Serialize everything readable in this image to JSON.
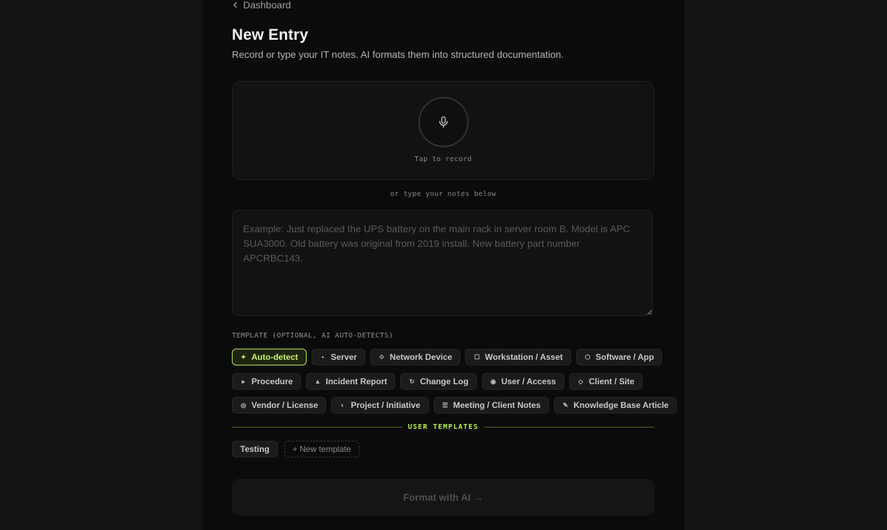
{
  "nav": {
    "back_label": "Dashboard"
  },
  "header": {
    "title": "New Entry",
    "subtitle": "Record or type your IT notes. AI formats them into structured documentation."
  },
  "recorder": {
    "label": "Tap to record"
  },
  "notes": {
    "separator": "or type your notes below",
    "placeholder": "Example: Just replaced the UPS battery on the main rack in server room B. Model is APC SUA3000. Old battery was original from 2019 install. New battery part number APCRBC143.",
    "value": ""
  },
  "templates": {
    "heading": "TEMPLATE (OPTIONAL, AI AUTO-DETECTS)",
    "selected": "Auto-detect",
    "rows": [
      [
        {
          "label": "Auto-detect",
          "icon": "sparkle-icon",
          "glyph": "✦"
        },
        {
          "label": "Server",
          "icon": "server-icon",
          "glyph": "▪"
        },
        {
          "label": "Network Device",
          "icon": "network-icon",
          "glyph": "⟐"
        },
        {
          "label": "Workstation / Asset",
          "icon": "monitor-icon",
          "glyph": "☐"
        },
        {
          "label": "Software / App",
          "icon": "hexagon-icon",
          "glyph": "⬡"
        }
      ],
      [
        {
          "label": "Procedure",
          "icon": "play-icon",
          "glyph": "▸"
        },
        {
          "label": "Incident Report",
          "icon": "warning-icon",
          "glyph": "▲"
        },
        {
          "label": "Change Log",
          "icon": "refresh-icon",
          "glyph": "↻"
        },
        {
          "label": "User / Access",
          "icon": "user-icon",
          "glyph": "◉"
        },
        {
          "label": "Client / Site",
          "icon": "diamond-icon",
          "glyph": "◇"
        }
      ],
      [
        {
          "label": "Vendor / License",
          "icon": "target-icon",
          "glyph": "◎"
        },
        {
          "label": "Project / Initiative",
          "icon": "half-circle-icon",
          "glyph": "◐"
        },
        {
          "label": "Meeting / Client Notes",
          "icon": "list-icon",
          "glyph": "☰"
        },
        {
          "label": "Knowledge Base Article",
          "icon": "pen-icon",
          "glyph": "✎"
        }
      ]
    ]
  },
  "user_templates": {
    "heading": "USER TEMPLATES",
    "items": [
      {
        "label": "Testing"
      }
    ],
    "new_label": "+ New template"
  },
  "actions": {
    "format_label": "Format with AI →"
  },
  "colors": {
    "accent": "#b8f24a",
    "background": "#141414",
    "panel": "#0b0b0b"
  }
}
